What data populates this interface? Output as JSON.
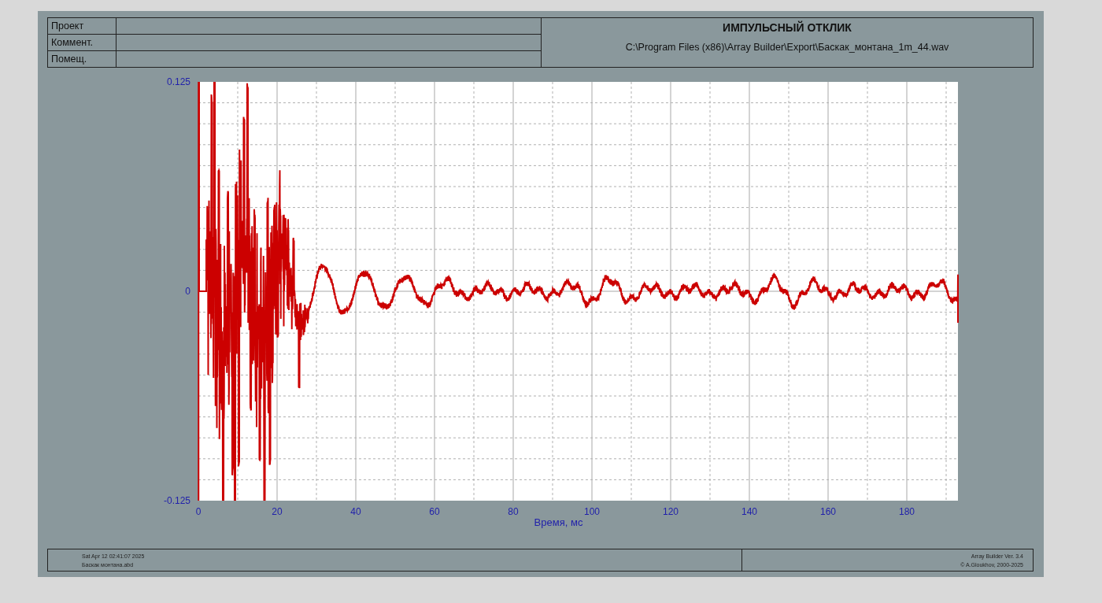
{
  "header": {
    "fields": [
      {
        "label": "Проект"
      },
      {
        "label": "Коммент."
      },
      {
        "label": "Помещ."
      }
    ],
    "title": "ИМПУЛЬСНЫЙ ОТКЛИК",
    "file_path": "C:\\Program Files (x86)\\Array Builder\\Export\\Баскак_монтана_1m_44.wav"
  },
  "plot": {
    "y_labels": [
      "0.125",
      "0",
      "-0.125"
    ],
    "x_labels": [
      "0",
      "20",
      "40",
      "60",
      "80",
      "100",
      "120",
      "140",
      "160",
      "180"
    ],
    "x_title": "Время, мс"
  },
  "footer": {
    "left": [
      "Sat Apr 12 02:41:07 2025",
      "Баскак монтана.abd"
    ],
    "right": [
      "Array Builder Ver. 3.4",
      "© A.Gloukhov, 2000-2025"
    ]
  }
}
